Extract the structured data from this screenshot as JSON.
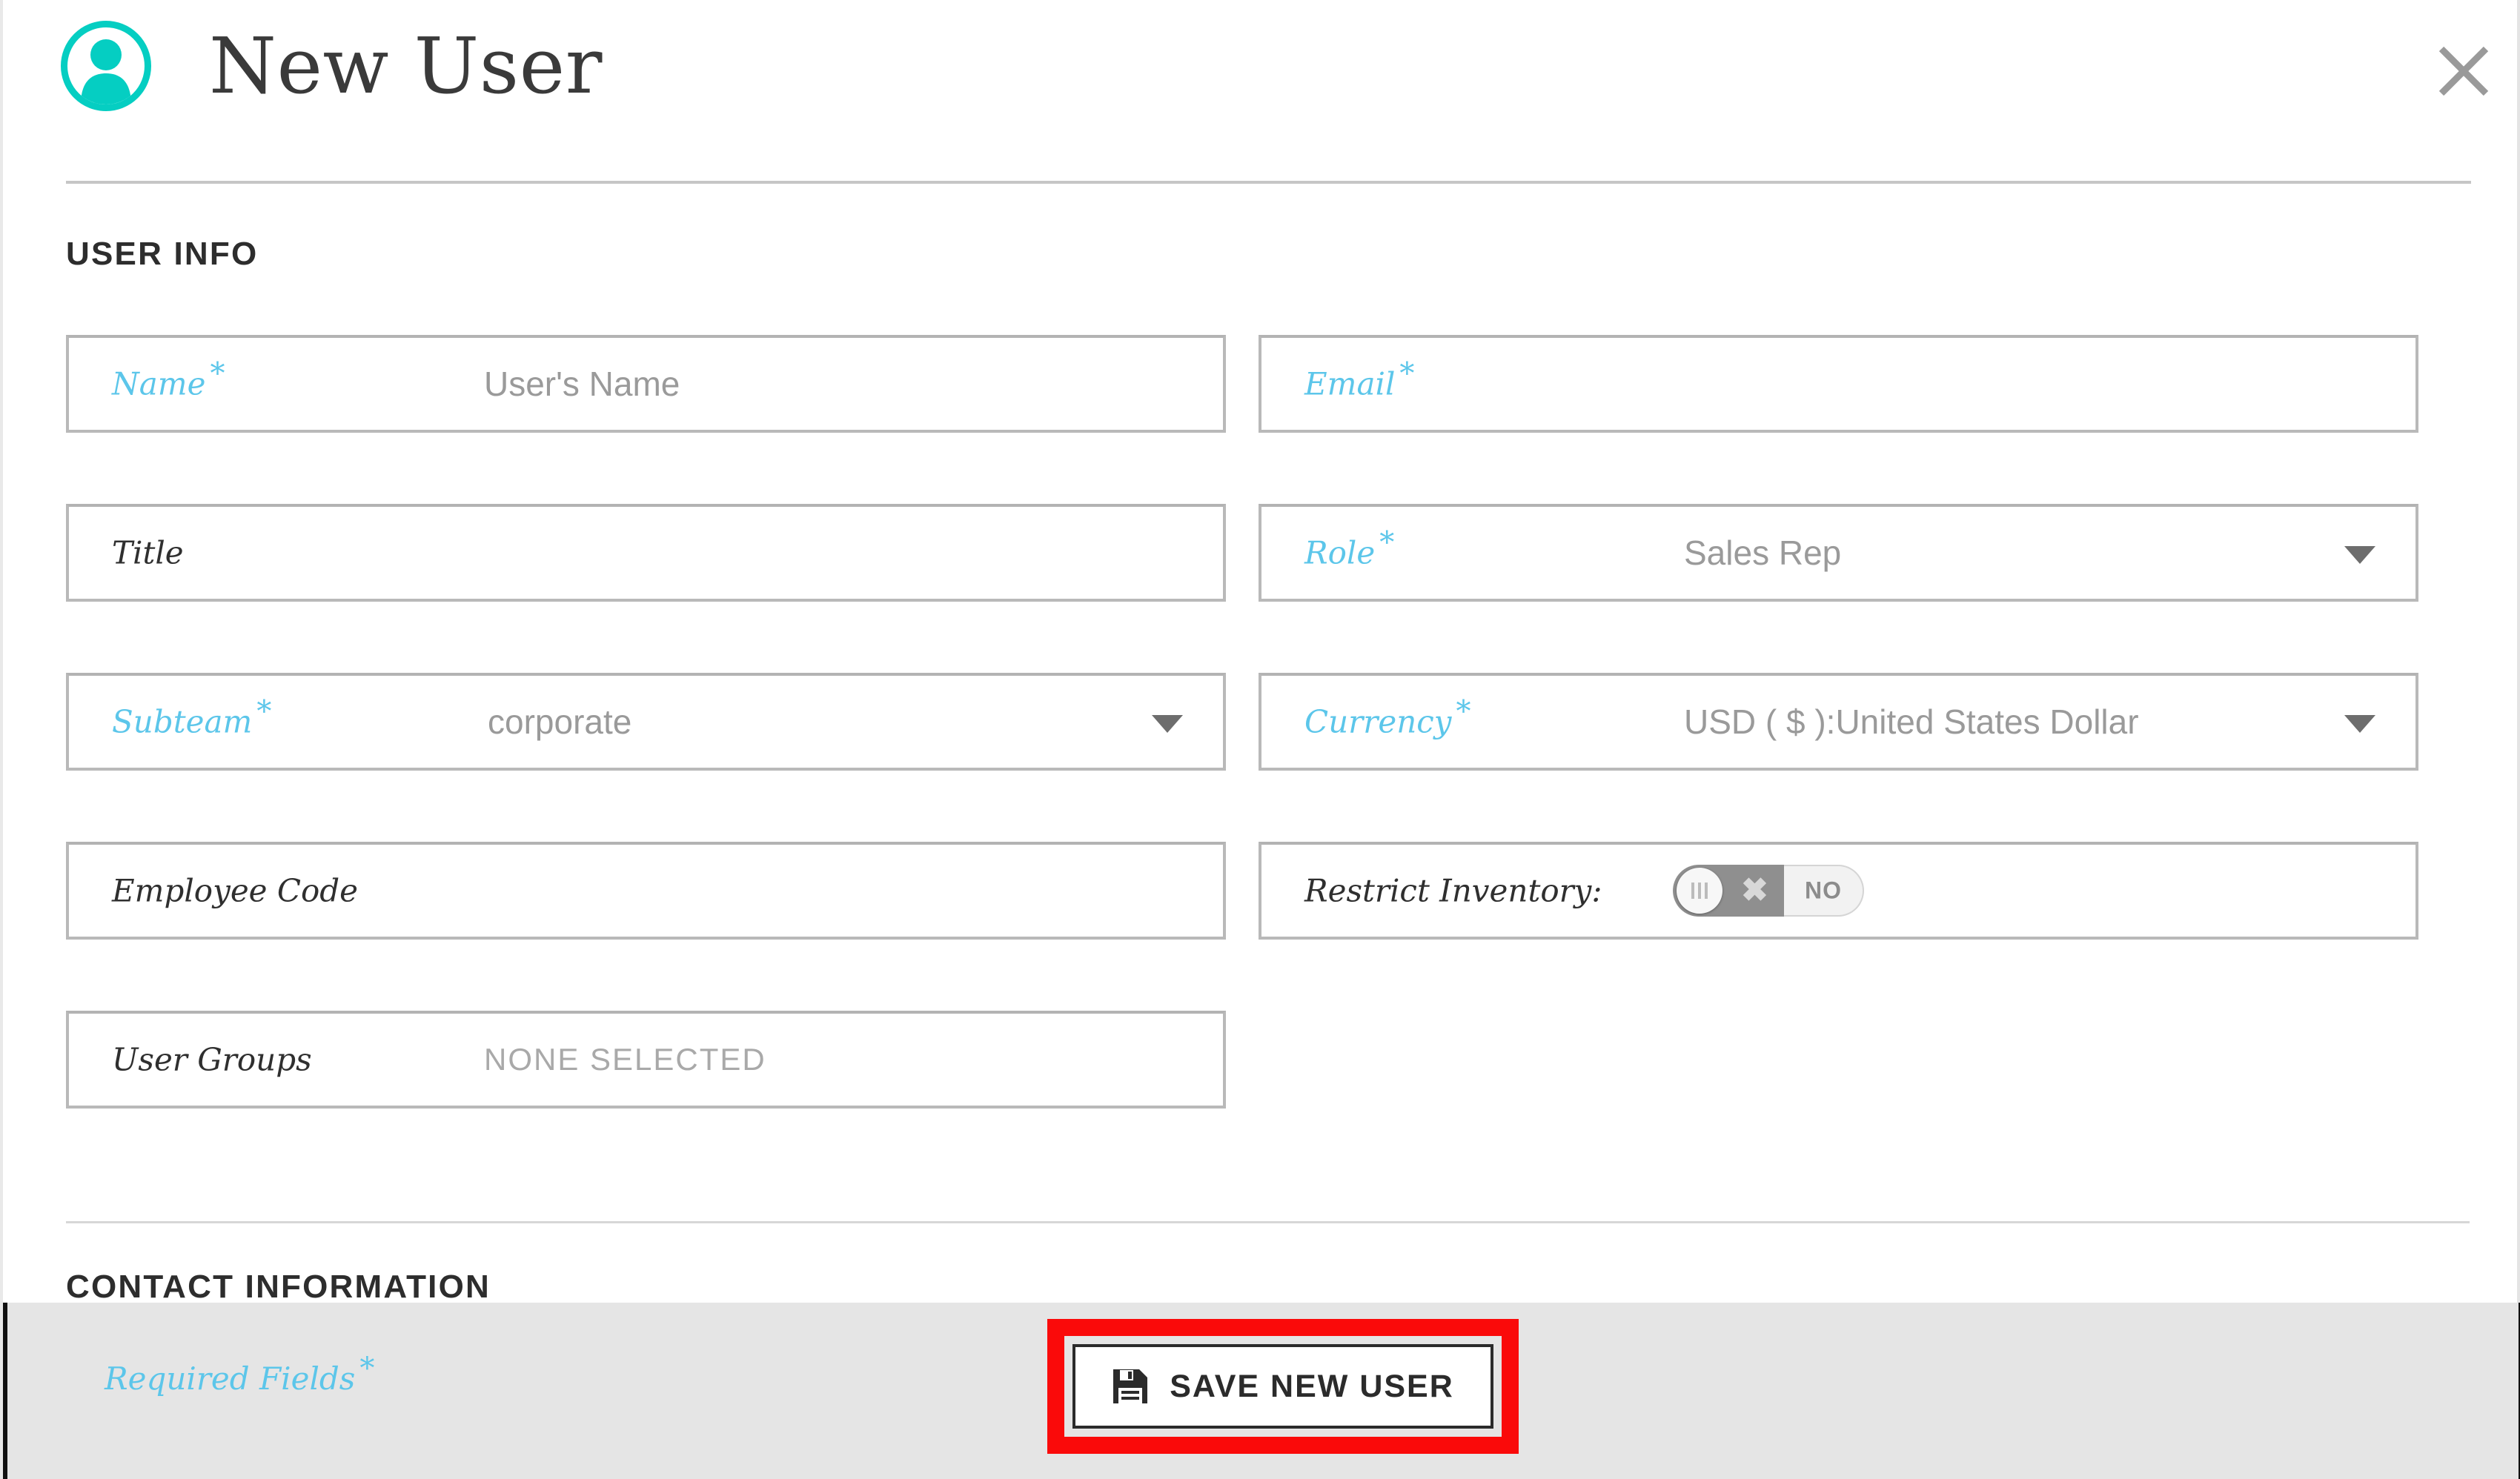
{
  "modal": {
    "title": "New User",
    "avatar_icon": "user-avatar-icon",
    "close_icon": "close-icon",
    "accent_color": "#05cec2",
    "required_label_color": "#5cc6ea"
  },
  "sections": {
    "user_info": {
      "heading": "USER INFO",
      "fields": [
        {
          "label": "Name",
          "required": true,
          "asterisk": "*",
          "value": "",
          "placeholder": "User's Name",
          "type": "text"
        },
        {
          "label": "Email",
          "required": true,
          "asterisk": "*",
          "value": "",
          "placeholder": "",
          "type": "text"
        },
        {
          "label": "Title",
          "required": false,
          "asterisk": "",
          "value": "",
          "placeholder": "",
          "type": "text"
        },
        {
          "label": "Role",
          "required": true,
          "asterisk": "*",
          "value": "Sales Rep",
          "placeholder": "",
          "type": "select"
        },
        {
          "label": "Subteam",
          "required": true,
          "asterisk": "*",
          "value": "corporate",
          "placeholder": "",
          "type": "select"
        },
        {
          "label": "Currency",
          "required": true,
          "asterisk": "*",
          "value": "USD ( $ ):United States Dollar",
          "placeholder": "",
          "type": "select"
        },
        {
          "label": "Employee Code",
          "required": false,
          "asterisk": "",
          "value": "",
          "placeholder": "",
          "type": "text"
        },
        {
          "label": "Restrict Inventory:",
          "required": false,
          "asterisk": "",
          "value": "NO",
          "placeholder": "",
          "type": "toggle"
        },
        {
          "label": "User Groups",
          "required": false,
          "asterisk": "",
          "value": "",
          "placeholder": "NONE SELECTED",
          "type": "multiselect"
        }
      ]
    },
    "contact_info": {
      "heading": "CONTACT INFORMATION"
    }
  },
  "toggle": {
    "off_label": "NO",
    "state": "off",
    "x_glyph": "✖"
  },
  "footer": {
    "required_note": "Required Fields",
    "required_note_asterisk": "*",
    "save_label": "SAVE NEW USER",
    "save_icon": "floppy-disk-save-icon",
    "highlight_color": "#fa0a0a"
  }
}
